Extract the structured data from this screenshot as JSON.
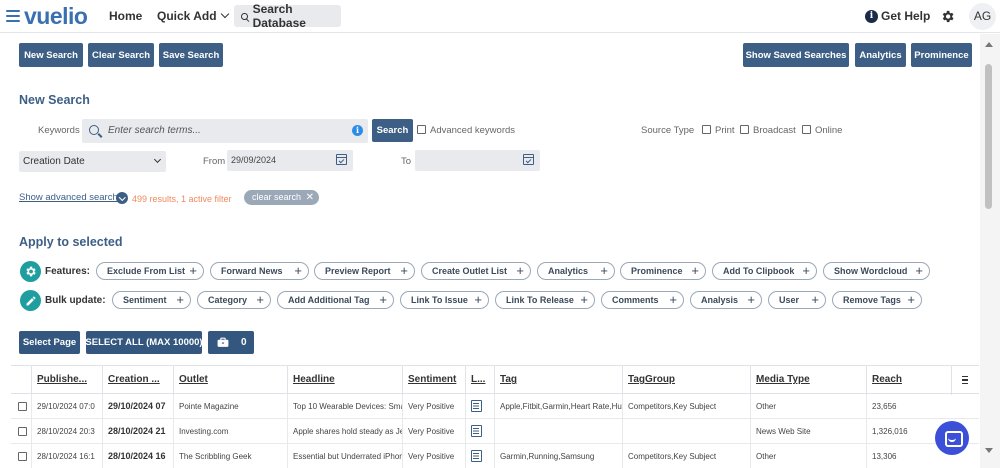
{
  "brand": {
    "logo_text": "vuelio"
  },
  "topnav": {
    "home": "Home",
    "quick_add": "Quick Add",
    "search_database": "Search Database",
    "get_help": "Get Help",
    "avatar_initials": "AG"
  },
  "toolbar": {
    "new_search": "New Search",
    "clear_search": "Clear Search",
    "save_search": "Save Search",
    "show_saved_searches": "Show Saved Searches",
    "analytics": "Analytics",
    "prominence": "Prominence"
  },
  "search": {
    "title": "New Search",
    "keywords_label": "Keywords",
    "keywords_placeholder": "Enter search terms...",
    "search_button": "Search",
    "advanced_keywords": "Advanced keywords",
    "source_type_label": "Source Type",
    "sources": [
      "Print",
      "Broadcast",
      "Online"
    ],
    "date_field": "Creation Date",
    "from_label": "From",
    "from_value": "29/09/2024",
    "to_label": "To",
    "to_value": "",
    "show_advanced": "Show advanced search",
    "results_info": "499 results, 1 active filter",
    "clear_chip": "clear search"
  },
  "apply": {
    "title": "Apply to selected",
    "features_label": "Features:",
    "features": [
      "Exclude From List",
      "Forward News",
      "Preview Report",
      "Create Outlet List",
      "Analytics",
      "Prominence",
      "Add To Clipbook",
      "Show Wordcloud"
    ],
    "bulk_label": "Bulk update:",
    "bulk": [
      "Sentiment",
      "Category",
      "Add Additional Tag",
      "Link To Issue",
      "Link To Release",
      "Comments",
      "Analysis",
      "User",
      "Remove Tags"
    ]
  },
  "selection": {
    "select_page": "Select Page",
    "select_all": "SELECT ALL (MAX 10000)",
    "count": "0"
  },
  "table": {
    "columns": [
      "Publishe...",
      "Creation ...",
      "Outlet",
      "Headline",
      "Sentiment",
      "L...",
      "Tag",
      "TagGroup",
      "Media Type",
      "Reach"
    ],
    "rows": [
      [
        "29/10/2024 07:0",
        "29/10/2024 07",
        "Pointe Magazine",
        "Top 10 Wearable Devices: Smart",
        "Very Positive",
        "",
        "Apple,Fitbit,Garmin,Heart Rate,Huav",
        "Competitors,Key Subject",
        "Other",
        "23,656"
      ],
      [
        "28/10/2024 20:3",
        "28/10/2024 21",
        "Investing.com",
        "Apple shares hold steady as Jeffe",
        "Very Positive",
        "",
        "",
        "",
        "News Web Site",
        "1,326,016"
      ],
      [
        "28/10/2024 16:1",
        "28/10/2024 16",
        "The Scribbling Geek",
        "Essential but Underrated iPhone F",
        "Very Positive",
        "",
        "Garmin,Running,Samsung",
        "Competitors,Key Subject",
        "Other",
        "13,306"
      ]
    ]
  }
}
